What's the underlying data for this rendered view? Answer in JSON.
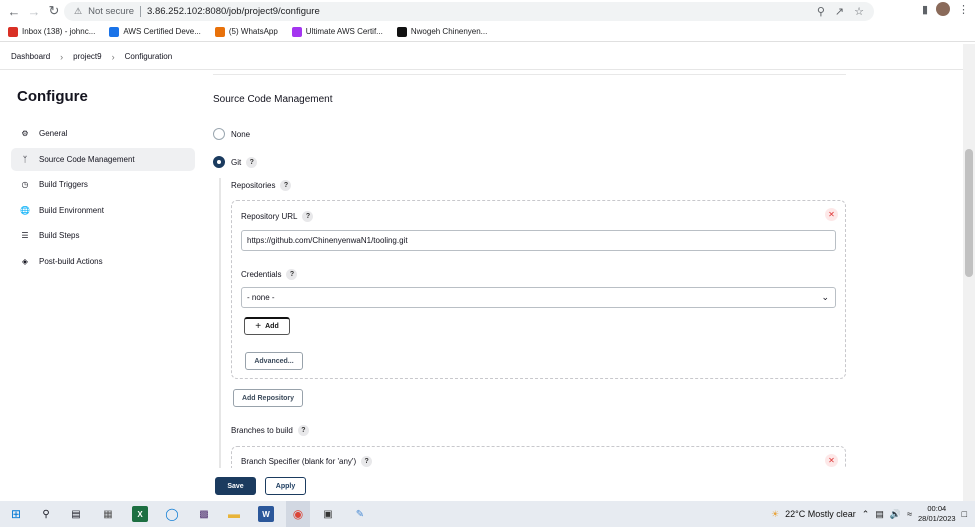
{
  "browser": {
    "not_secure": "Not secure",
    "url": "3.86.252.102:8080/job/project9/configure",
    "bookmarks": [
      {
        "label": "Inbox (138) - johnc...",
        "icon": "gmail-icon",
        "color": "#d93025"
      },
      {
        "label": "AWS Certified Deve...",
        "icon": "stack-icon",
        "color": "#1a73e8"
      },
      {
        "label": "(5) WhatsApp",
        "icon": "whatsapp-icon",
        "color": "#e8710a"
      },
      {
        "label": "Ultimate AWS Certif...",
        "icon": "udemy-icon",
        "color": "#a435f0"
      },
      {
        "label": "Nwogeh Chinenyen...",
        "icon": "dev-icon",
        "color": "#111111"
      }
    ]
  },
  "breadcrumb": [
    "Dashboard",
    "project9",
    "Configuration"
  ],
  "sidebar": {
    "title": "Configure",
    "items": [
      {
        "label": "General",
        "icon": "gear-icon",
        "active": false
      },
      {
        "label": "Source Code Management",
        "icon": "branch-icon",
        "active": true
      },
      {
        "label": "Build Triggers",
        "icon": "clock-icon",
        "active": false
      },
      {
        "label": "Build Environment",
        "icon": "globe-icon",
        "active": false
      },
      {
        "label": "Build Steps",
        "icon": "list-icon",
        "active": false
      },
      {
        "label": "Post-build Actions",
        "icon": "cube-icon",
        "active": false
      }
    ]
  },
  "scm": {
    "title": "Source Code Management",
    "none_label": "None",
    "git_label": "Git",
    "repositories_label": "Repositories",
    "repo_url_label": "Repository URL",
    "repo_url_value": "https://github.com/ChinenyenwaN1/tooling.git",
    "credentials_label": "Credentials",
    "credentials_value": "- none -",
    "add_label": "Add",
    "advanced_label": "Advanced...",
    "add_repository_label": "Add Repository",
    "branches_label": "Branches to build",
    "branch_specifier_label": "Branch Specifier (blank for 'any')"
  },
  "footer": {
    "save": "Save",
    "apply": "Apply"
  },
  "taskbar": {
    "weather": "22°C  Mostly clear",
    "time": "00:04",
    "date": "28/01/2023"
  },
  "colors": {
    "accent": "#1b3b5f",
    "active_bg": "#eff0f2"
  }
}
